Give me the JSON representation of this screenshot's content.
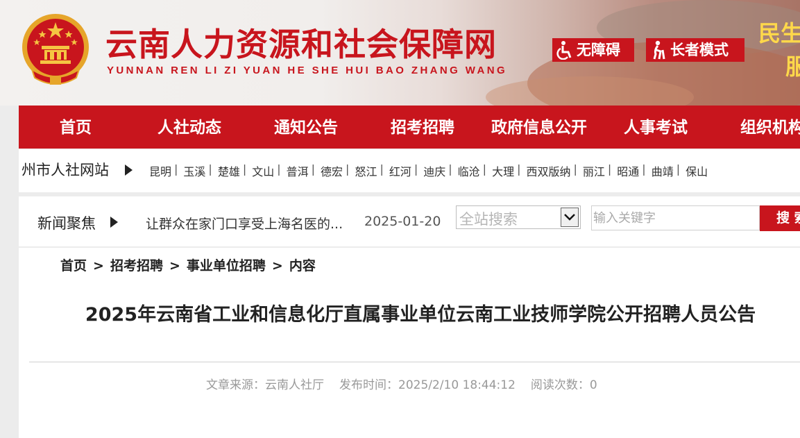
{
  "header": {
    "site_title": "云南人力资源和社会保障网",
    "site_subtitle": "YUNNAN REN LI ZI YUAN HE SHE HUI BAO ZHANG WANG",
    "accessibility_label": "无障碍",
    "elder_mode_label": "长者模式",
    "slogan_line1": "民生",
    "slogan_line2": "服",
    "brand_color": "#c8151d",
    "slogan_color": "#ffd84a"
  },
  "nav": {
    "items": [
      "首页",
      "人社动态",
      "通知公告",
      "招考招聘",
      "政府信息公开",
      "人事考试",
      "组织机构"
    ]
  },
  "cities": {
    "title": "州市人社网站",
    "items": [
      "昆明",
      "玉溪",
      "楚雄",
      "文山",
      "普洱",
      "德宏",
      "怒江",
      "红河",
      "迪庆",
      "临沧",
      "大理",
      "西双版纳",
      "丽江",
      "昭通",
      "曲靖",
      "保山"
    ]
  },
  "news": {
    "title": "新闻聚焦",
    "headline": "让群众在家门口享受上海名医的...",
    "date": "2025-01-20"
  },
  "search": {
    "scope": "全站搜索",
    "placeholder": "输入关键字",
    "button": "搜 索"
  },
  "breadcrumb": [
    "首页",
    "招考招聘",
    "事业单位招聘",
    "内容"
  ],
  "article": {
    "title": "2025年云南省工业和信息化厅直属事业单位云南工业技师学院公开招聘人员公告",
    "source_label": "文章来源：",
    "source": "云南人社厅",
    "time_label": "发布时间：",
    "time": "2025/2/10 18:44:12",
    "views_label": "阅读次数：",
    "views": "0"
  }
}
